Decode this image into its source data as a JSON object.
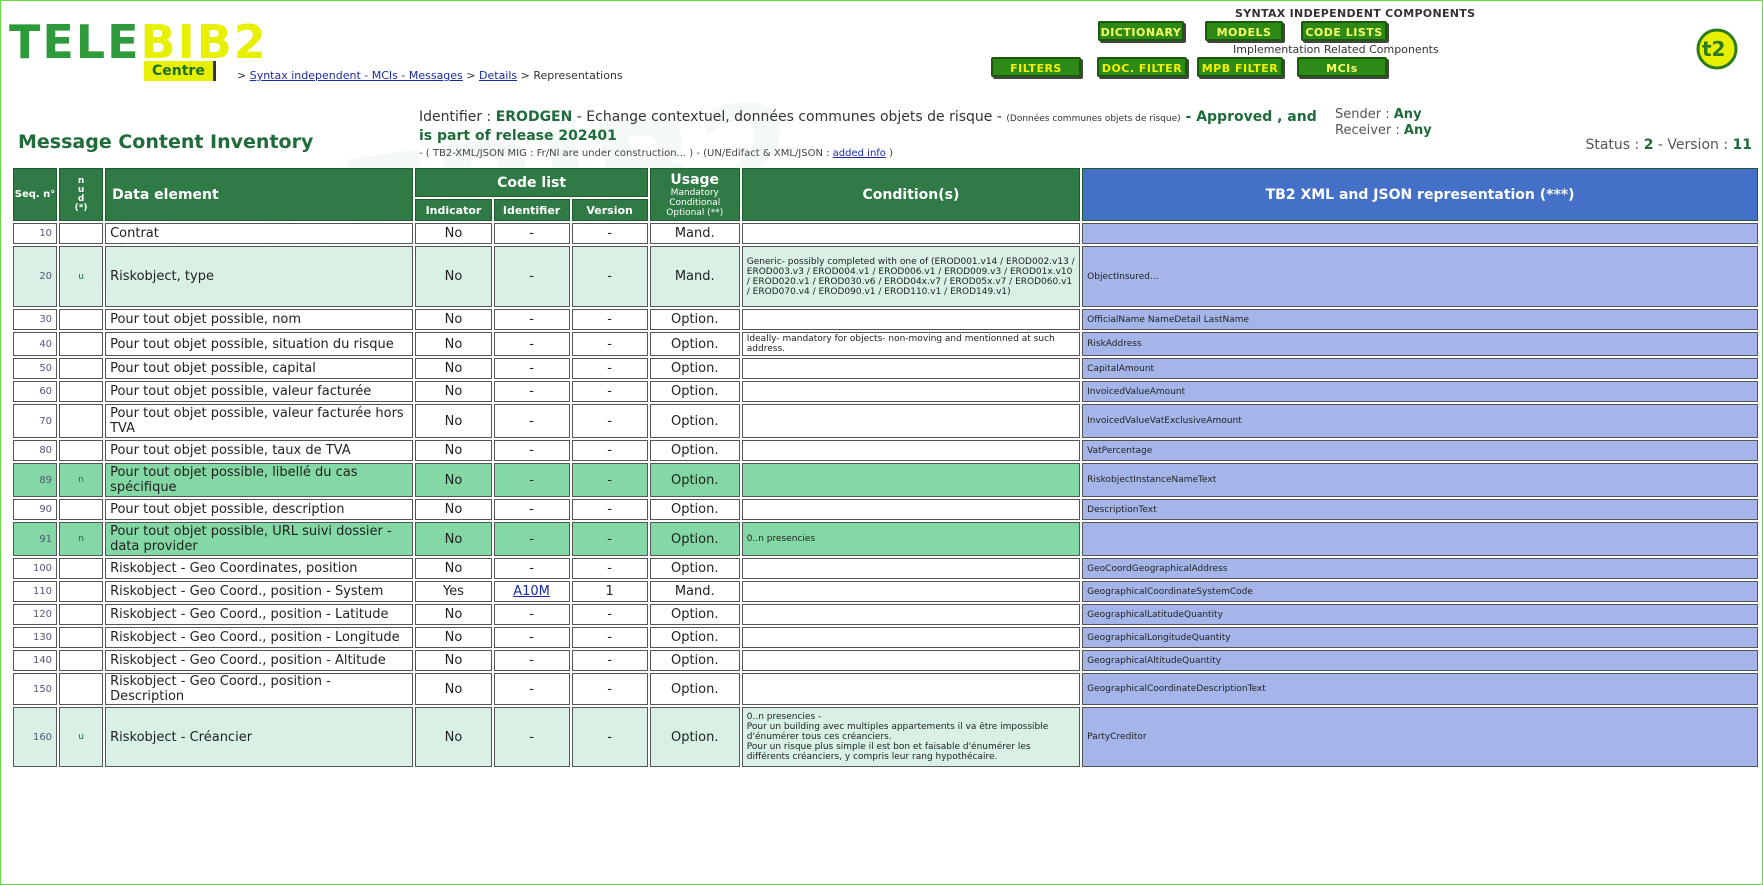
{
  "logo": {
    "main_a": "TELE",
    "main_b": "BIB2",
    "sub": "Centre"
  },
  "breadcrumb": {
    "sep": ">",
    "items": [
      {
        "label": "Syntax independent - MCIs - Messages",
        "link": true
      },
      {
        "label": "Details",
        "link": true
      },
      {
        "label": "Representations",
        "link": false
      }
    ]
  },
  "components": {
    "title_top": "SYNTAX INDEPENDENT COMPONENTS",
    "title_mid": "Implementation Related Components",
    "buttons_top": [
      "DICTIONARY",
      "MODELS",
      "CODE LISTS"
    ],
    "buttons_bottom": [
      "FILTERS",
      "DOC. FILTER",
      "MPB FILTER",
      "MCIs"
    ]
  },
  "header": {
    "page_title": "Message Content Inventory",
    "identifier_label": "Identifier :",
    "identifier_code": "ERODGEN",
    "identifier_desc": " - Echange contextuel, données communes objets de risque - ",
    "identifier_small": "(Données communes objets de risque)",
    "status_phrase": " - Approved , and is part of release 202401",
    "line2_a": "- ( TB2-XML/JSON MIG : Fr/Nl are under construction... ) - (UN/Edifact & XML/JSON : ",
    "line2_link": "added info",
    "line2_b": " )",
    "sender_label": "Sender :",
    "sender_value": "Any",
    "receiver_label": "Receiver :",
    "receiver_value": "Any",
    "status_label": "Status :",
    "status_value": "2",
    "version_label": "Version :",
    "version_value": "11"
  },
  "table": {
    "headers": {
      "seq": "Seq. n°",
      "nud": [
        "n",
        "u",
        "d",
        "(*)"
      ],
      "data_element": "Data element",
      "code_list": "Code list",
      "indicator": "Indicator",
      "identifier": "Identifier",
      "version": "Version",
      "usage": "Usage",
      "usage_sub": [
        "Mandatory",
        "Conditional",
        "Optional (**)"
      ],
      "conditions": "Condition(s)",
      "representation": "TB2 XML and JSON representation (***)"
    },
    "rows": [
      {
        "seq": "10",
        "nud": "",
        "el": "Contrat",
        "ind": "No",
        "id": "-",
        "ver": "-",
        "usage": "Mand.",
        "cond": "",
        "repr": "",
        "kind": "w"
      },
      {
        "seq": "20",
        "nud": "u",
        "el": "Riskobject, type",
        "ind": "No",
        "id": "-",
        "ver": "-",
        "usage": "Mand.",
        "cond": "Generic- possibly completed with one of (EROD001.v14 / EROD002.v13 / EROD003.v3 / EROD004.v1 / EROD006.v1 / EROD009.v3 / EROD01x.v10 / EROD020.v1 / EROD030.v6 / EROD04x.v7 / EROD05x.v7 / EROD060.v1 / EROD070.v4 / EROD090.v1 / EROD110.v1 / EROD149.v1)",
        "repr": "ObjectInsured...",
        "kind": "u"
      },
      {
        "seq": "30",
        "nud": "",
        "el": "Pour tout objet possible, nom",
        "ind": "No",
        "id": "-",
        "ver": "-",
        "usage": "Option.",
        "cond": "",
        "repr": "OfficialName NameDetail LastName",
        "kind": "w"
      },
      {
        "seq": "40",
        "nud": "",
        "el": "Pour tout objet possible, situation du risque",
        "ind": "No",
        "id": "-",
        "ver": "-",
        "usage": "Option.",
        "cond": "Ideally- mandatory for objects- non-moving and mentionned at such address.",
        "repr": "RiskAddress",
        "kind": "w"
      },
      {
        "seq": "50",
        "nud": "",
        "el": "Pour tout objet possible, capital",
        "ind": "No",
        "id": "-",
        "ver": "-",
        "usage": "Option.",
        "cond": "",
        "repr": "CapitalAmount",
        "kind": "w"
      },
      {
        "seq": "60",
        "nud": "",
        "el": "Pour tout objet possible, valeur facturée",
        "ind": "No",
        "id": "-",
        "ver": "-",
        "usage": "Option.",
        "cond": "",
        "repr": "InvoicedValueAmount",
        "kind": "w"
      },
      {
        "seq": "70",
        "nud": "",
        "el": "Pour tout objet possible, valeur facturée hors TVA",
        "ind": "No",
        "id": "-",
        "ver": "-",
        "usage": "Option.",
        "cond": "",
        "repr": "InvoicedValueVatExclusiveAmount",
        "kind": "w"
      },
      {
        "seq": "80",
        "nud": "",
        "el": "Pour tout objet possible, taux de TVA",
        "ind": "No",
        "id": "-",
        "ver": "-",
        "usage": "Option.",
        "cond": "",
        "repr": "VatPercentage",
        "kind": "w"
      },
      {
        "seq": "89",
        "nud": "n",
        "el": "Pour tout objet possible, libellé du cas spécifique",
        "ind": "No",
        "id": "-",
        "ver": "-",
        "usage": "Option.",
        "cond": "",
        "repr": "RiskobjectInstanceNameText",
        "kind": "n"
      },
      {
        "seq": "90",
        "nud": "",
        "el": "Pour tout objet possible, description",
        "ind": "No",
        "id": "-",
        "ver": "-",
        "usage": "Option.",
        "cond": "",
        "repr": "DescriptionText",
        "kind": "w"
      },
      {
        "seq": "91",
        "nud": "n",
        "el": "Pour tout objet possible, URL suivi dossier - data provider",
        "ind": "No",
        "id": "-",
        "ver": "-",
        "usage": "Option.",
        "cond": "0..n presencies",
        "repr": "",
        "kind": "n"
      },
      {
        "seq": "100",
        "nud": "",
        "el": "Riskobject - Geo Coordinates, position",
        "ind": "No",
        "id": "-",
        "ver": "-",
        "usage": "Option.",
        "cond": "",
        "repr": "GeoCoordGeographicalAddress",
        "kind": "w"
      },
      {
        "seq": "110",
        "nud": "",
        "el": "Riskobject - Geo Coord., position - System",
        "ind": "Yes",
        "id": "A10M",
        "ver": "1",
        "usage": "Mand.",
        "cond": "",
        "repr": "GeographicalCoordinateSystemCode",
        "kind": "w"
      },
      {
        "seq": "120",
        "nud": "",
        "el": "Riskobject - Geo Coord., position - Latitude",
        "ind": "No",
        "id": "-",
        "ver": "-",
        "usage": "Option.",
        "cond": "",
        "repr": "GeographicalLatitudeQuantity",
        "kind": "w"
      },
      {
        "seq": "130",
        "nud": "",
        "el": "Riskobject - Geo Coord., position - Longitude",
        "ind": "No",
        "id": "-",
        "ver": "-",
        "usage": "Option.",
        "cond": "",
        "repr": "GeographicalLongitudeQuantity",
        "kind": "w"
      },
      {
        "seq": "140",
        "nud": "",
        "el": "Riskobject - Geo Coord., position - Altitude",
        "ind": "No",
        "id": "-",
        "ver": "-",
        "usage": "Option.",
        "cond": "",
        "repr": "GeographicalAltitudeQuantity",
        "kind": "w"
      },
      {
        "seq": "150",
        "nud": "",
        "el": "Riskobject - Geo Coord., position - Description",
        "ind": "No",
        "id": "-",
        "ver": "-",
        "usage": "Option.",
        "cond": "",
        "repr": "GeographicalCoordinateDescriptionText",
        "kind": "w"
      },
      {
        "seq": "160",
        "nud": "u",
        "el": "Riskobject - Créancier",
        "ind": "No",
        "id": "-",
        "ver": "-",
        "usage": "Option.",
        "cond": "0..n presencies -\nPour un building avec multiples appartements il va être impossible d'énumérer tous ces créanciers.\nPour un risque plus simple il est bon et faisable d'énumérer les différents créanciers, y compris leur rang hypothécaire.",
        "repr": "PartyCreditor",
        "kind": "u"
      }
    ]
  },
  "colors": {
    "header_green": "#2f7a45",
    "repr_blue": "#4470c8",
    "repr_cell": "#a6b5e9",
    "row_u": "#d8f1e4",
    "row_n": "#84d8a6",
    "logo_green": "#2d9b3a",
    "logo_yellow": "#e7f000"
  }
}
